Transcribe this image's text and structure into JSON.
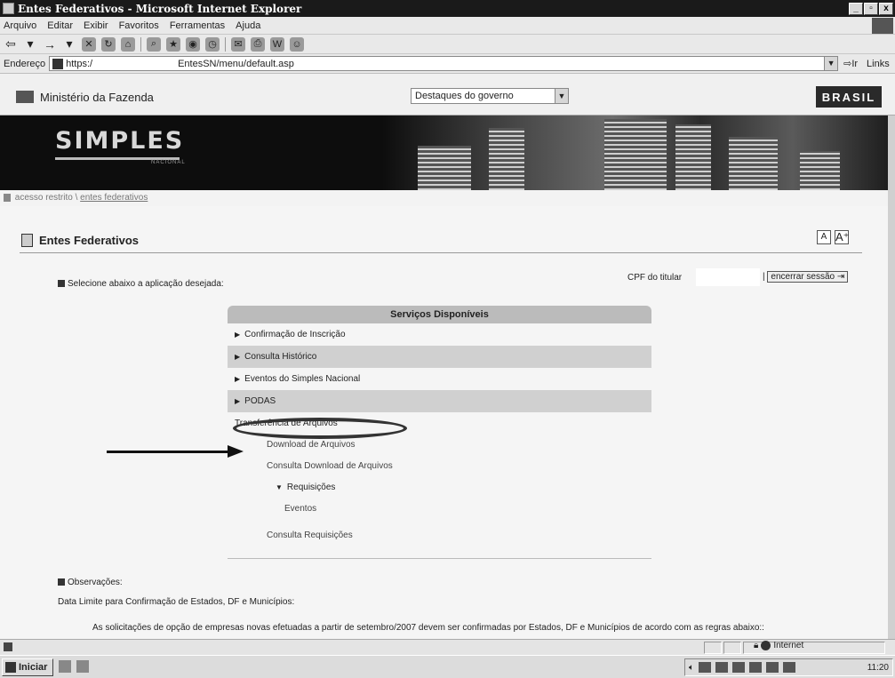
{
  "window": {
    "title": "Entes Federativos - Microsoft Internet Explorer",
    "controls": [
      "_",
      "́",
      "x"
    ]
  },
  "menu": {
    "items": [
      "Arquivo",
      "Editar",
      "Exibir",
      "Favoritos",
      "Ferramentas",
      "Ajuda"
    ]
  },
  "toolbar": {
    "icons": [
      "back-icon",
      "forward-icon",
      "stop-icon",
      "refresh-icon",
      "home-icon",
      "search-icon",
      "favorites-icon",
      "media-icon",
      "history-icon",
      "mail-icon",
      "print-icon",
      "word-icon",
      "messenger-icon"
    ]
  },
  "address": {
    "label": "Endereço",
    "url_start": "https:/",
    "url_end": "EntesSN/menu/default.asp",
    "go_label": "Ir",
    "links_label": "Links"
  },
  "header": {
    "ministry": "Ministério da Fazenda",
    "destaques": "Destaques do governo",
    "brasil_logo": "BRASIL"
  },
  "banner": {
    "logo_text": "SIMPLES",
    "logo_sub": "NACIONAL"
  },
  "breadcrumb": {
    "root": "acesso restrito",
    "separator": " \\ ",
    "current": "entes federativos"
  },
  "section": {
    "title": "Entes Federativos",
    "font_small": "A",
    "font_large": "A⁺"
  },
  "intro": {
    "selecione": "Selecione abaixo a aplicação desejada:",
    "cpf_label": "CPF do titular",
    "encerrar": "encerrar sessão"
  },
  "services": {
    "header": "Serviços Disponíveis",
    "items": [
      "Confirmação de Inscrição",
      "Consulta Histórico",
      "Eventos do Simples Nacional",
      "PODAS"
    ],
    "transferencia": "Transferência de Arquivos",
    "sub_items": [
      "Download de Arquivos",
      "Consulta Download de Arquivos"
    ],
    "requisicoes": "Requisições",
    "eventos": "Eventos",
    "consulta_requisicoes": "Consulta Requisições"
  },
  "notes": {
    "observacoes": "Observações:",
    "data_limite": "Data Limite para Confirmação de Estados, DF e Municípios:",
    "solicitacoes": "As solicitações de opção de empresas novas efetuadas a partir de setembro/2007 devem ser confirmadas por Estados, DF e Municípios de acordo com as regras abaixo::"
  },
  "status": {
    "zone": "Internet"
  },
  "taskbar": {
    "start": "Iniciar",
    "clock": "11:20"
  }
}
